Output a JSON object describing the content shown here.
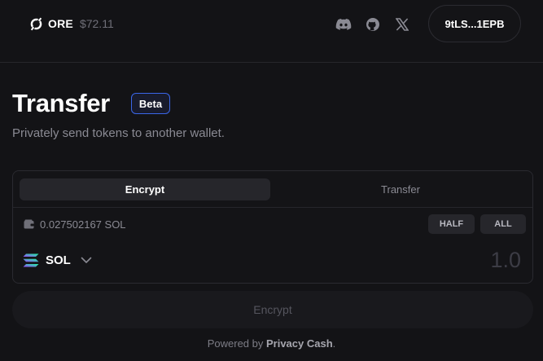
{
  "header": {
    "brand_name": "ORE",
    "brand_price": "$72.11",
    "social_icons": [
      "discord-icon",
      "github-icon",
      "x-icon"
    ],
    "wallet_label": "9tLS...1EPB"
  },
  "page": {
    "title": "Transfer",
    "badge": "Beta",
    "subtitle": "Privately send tokens to another wallet."
  },
  "card": {
    "tabs": [
      {
        "label": "Encrypt",
        "active": true
      },
      {
        "label": "Transfer",
        "active": false
      }
    ],
    "balance": "0.027502167 SOL",
    "half_label": "HALF",
    "all_label": "ALL",
    "token": "SOL",
    "amount_placeholder": "1.0"
  },
  "action": {
    "button_label": "Encrypt"
  },
  "footer": {
    "prefix": "Powered by ",
    "link": "Privacy Cash",
    "suffix": "."
  },
  "colors": {
    "background": "#131316",
    "accent_border": "#3a66e8",
    "sol_gradient": [
      "#9945ff",
      "#19fb9b"
    ]
  }
}
